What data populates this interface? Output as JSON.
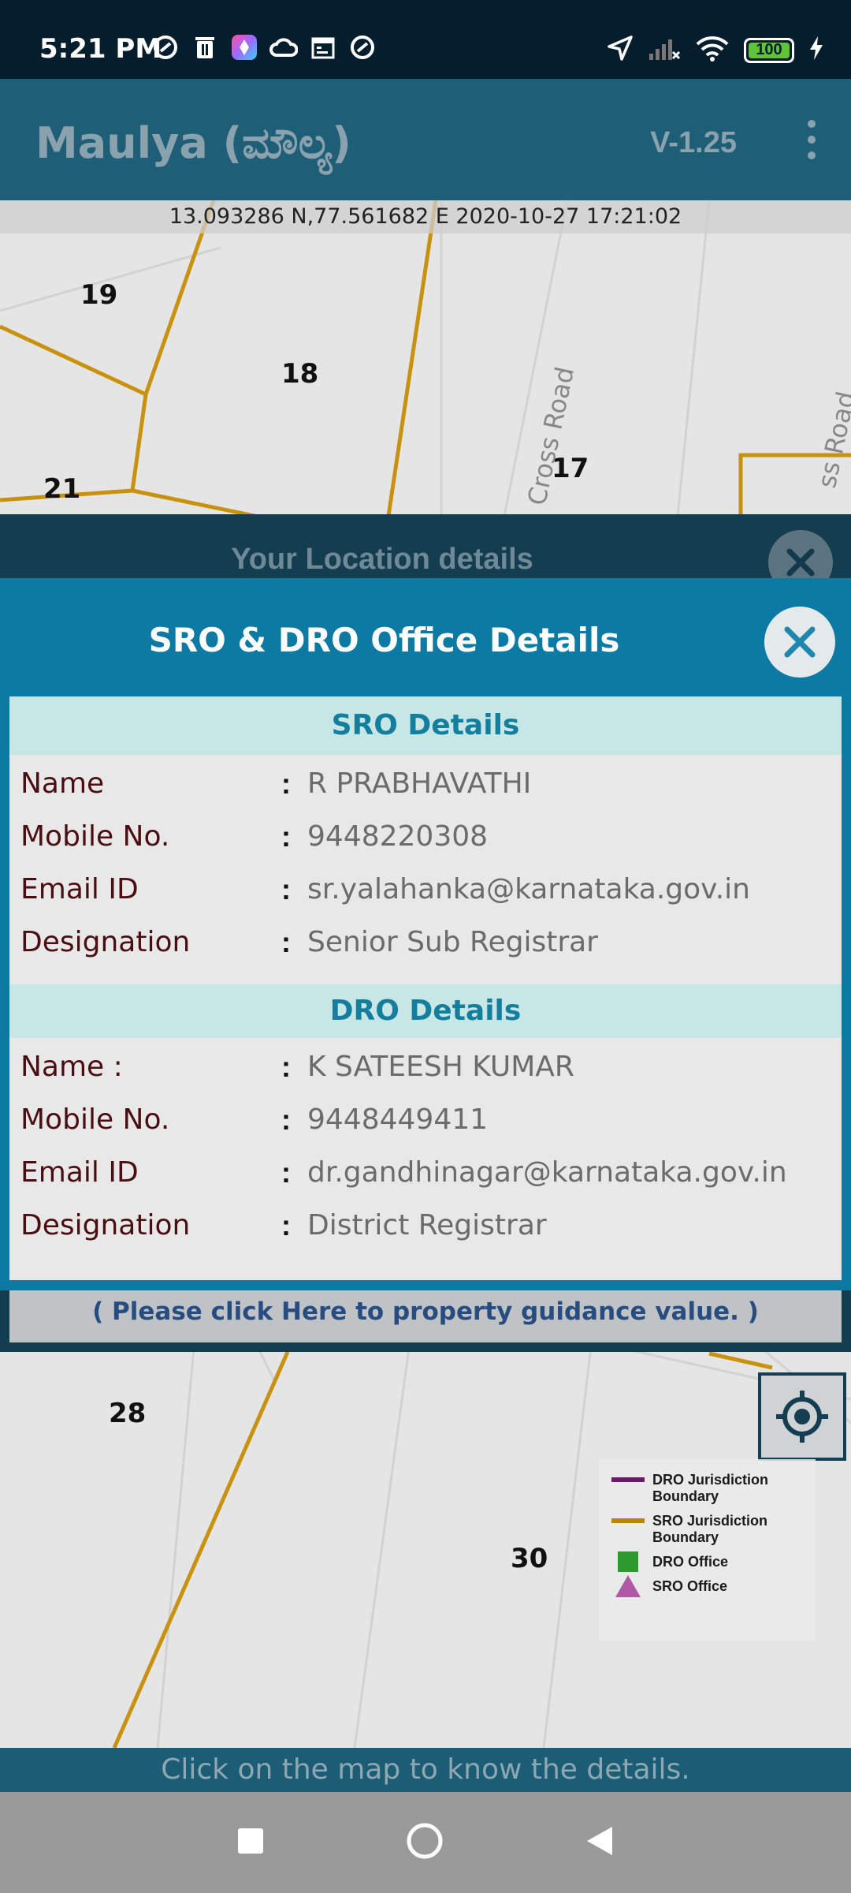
{
  "status_bar": {
    "time": "5:21 PM",
    "battery": "100"
  },
  "app_bar": {
    "title": "Maulya (ಮೌಲ್ಯ)",
    "version": "V-1.25"
  },
  "map": {
    "coordinates": "13.093286 N,77.561682 E   2020-10-27 17:21:02",
    "plots": [
      "19",
      "18",
      "21",
      "17",
      "28",
      "30"
    ],
    "roads": [
      "Cross Road",
      "ss Road"
    ]
  },
  "location_panel": {
    "title": "Your Location details",
    "footer_link": "( Please click Here to property guidance value. )"
  },
  "dialog": {
    "title": "SRO & DRO Office Details",
    "sro": {
      "heading": "SRO Details",
      "rows": [
        {
          "label": "Name",
          "value": "R PRABHAVATHI"
        },
        {
          "label": "Mobile No.",
          "value": "9448220308"
        },
        {
          "label": "Email ID",
          "value": "sr.yalahanka@karnataka.gov.in"
        },
        {
          "label": "Designation",
          "value": "Senior Sub Registrar"
        }
      ]
    },
    "dro": {
      "heading": "DRO Details",
      "rows": [
        {
          "label": "Name :",
          "value": "K SATEESH KUMAR"
        },
        {
          "label": "Mobile No.",
          "value": "9448449411"
        },
        {
          "label": "Email ID",
          "value": "dr.gandhinagar@karnataka.gov.in"
        },
        {
          "label": "Designation",
          "value": "District Registrar"
        }
      ]
    },
    "colon": ":"
  },
  "legend": {
    "items": [
      {
        "label": "DRO Jurisdiction Boundary",
        "color": "#6a1b6e"
      },
      {
        "label": "SRO Jurisdiction Boundary",
        "color": "#b8860b"
      },
      {
        "label": "DRO Office",
        "color": "#2e9a2e"
      },
      {
        "label": "SRO Office",
        "color": "#b05aa6"
      }
    ]
  },
  "bottom_hint": "Click on the map to know the details."
}
